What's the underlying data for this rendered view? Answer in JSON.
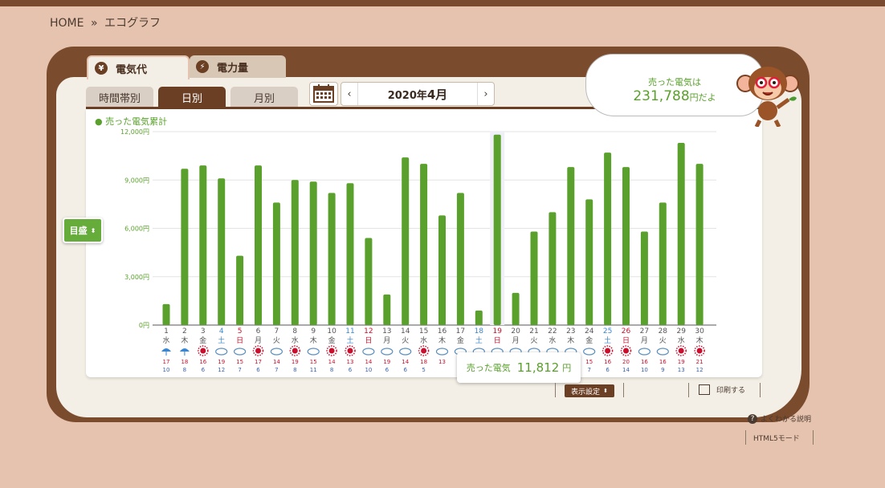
{
  "breadcrumb": {
    "home": "HOME",
    "sep": "»",
    "current": "エコグラフ"
  },
  "tabs": {
    "money": "電気代",
    "power": "電力量"
  },
  "subtabs": [
    "時間帯別",
    "日別",
    "月別"
  ],
  "date": {
    "year": "2020年",
    "month": "4月"
  },
  "summary": {
    "label": "売った電気は",
    "value": "231,788",
    "suffix": "円だよ"
  },
  "scale_button": "目盛",
  "tooltip": {
    "label": "売った電気",
    "value": "11,812",
    "unit": "円"
  },
  "footer": {
    "display": "表示設定",
    "print": "印刷する",
    "help": "よくわかる説明",
    "html5": "HTML5モード"
  },
  "colors": {
    "bar": "#5aa02c",
    "brown": "#6b3f24",
    "saturday": "#3a86d0",
    "sunday": "#c8102e"
  },
  "chart_data": {
    "type": "bar",
    "legend": "売った電気累計",
    "ylim": [
      0,
      12000
    ],
    "ytick_labels": [
      "0円",
      "3,000円",
      "6,000円",
      "9,000円",
      "12,000円"
    ],
    "ytick_values": [
      0,
      3000,
      6000,
      9000,
      12000
    ],
    "categories": [
      "1",
      "2",
      "3",
      "4",
      "5",
      "6",
      "7",
      "8",
      "9",
      "10",
      "11",
      "12",
      "13",
      "14",
      "15",
      "16",
      "17",
      "18",
      "19",
      "20",
      "21",
      "22",
      "23",
      "24",
      "25",
      "26",
      "27",
      "28",
      "29",
      "30"
    ],
    "weekdays": [
      "水",
      "木",
      "金",
      "土",
      "日",
      "月",
      "火",
      "水",
      "木",
      "金",
      "土",
      "日",
      "月",
      "火",
      "水",
      "木",
      "金",
      "土",
      "日",
      "月",
      "火",
      "水",
      "木",
      "金",
      "土",
      "日",
      "月",
      "火",
      "水",
      "木"
    ],
    "values": [
      1300,
      9700,
      9900,
      9100,
      4300,
      9900,
      7600,
      9000,
      8900,
      8200,
      8800,
      5400,
      1900,
      10400,
      10000,
      6800,
      8200,
      900,
      11812,
      2000,
      5800,
      7000,
      9800,
      7800,
      10700,
      9800,
      5800,
      7600,
      11300,
      10000
    ],
    "weather": [
      "rain",
      "rain",
      "sun",
      "cloud",
      "cloud",
      "sun",
      "cloud",
      "sun",
      "cloud",
      "sun",
      "sun",
      "cloud",
      "cloud",
      "cloud",
      "sun",
      "cloud",
      "cloud",
      "cloud",
      "cloud",
      "cloud",
      "cloud",
      "cloud",
      "cloud",
      "cloud",
      "sun",
      "sun",
      "cloud",
      "cloud",
      "sun",
      "sun"
    ],
    "temp_high": [
      "17",
      "18",
      "16",
      "19",
      "15",
      "17",
      "14",
      "19",
      "15",
      "14",
      "13",
      "14",
      "19",
      "14",
      "18",
      "13",
      "",
      "",
      "",
      "",
      "",
      "",
      "",
      "15",
      "16",
      "20",
      "16",
      "16",
      "19",
      "21"
    ],
    "temp_low": [
      "10",
      "8",
      "6",
      "12",
      "7",
      "6",
      "7",
      "8",
      "11",
      "8",
      "6",
      "10",
      "6",
      "6",
      "5",
      "",
      "",
      "",
      "",
      "",
      "",
      "",
      "",
      "7",
      "6",
      "14",
      "10",
      "9",
      "13",
      "12"
    ],
    "highlight_index": 18
  }
}
